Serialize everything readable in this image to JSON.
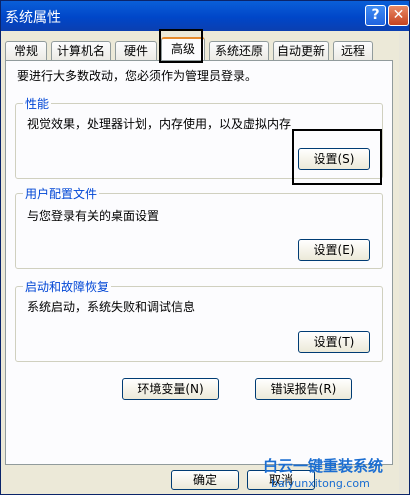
{
  "window": {
    "title": "系统属性",
    "help_glyph": "?",
    "close_glyph": "✕"
  },
  "tabs": [
    {
      "label": "常规"
    },
    {
      "label": "计算机名"
    },
    {
      "label": "硬件"
    },
    {
      "label": "高级",
      "active": true
    },
    {
      "label": "系统还原"
    },
    {
      "label": "自动更新"
    },
    {
      "label": "远程"
    }
  ],
  "intro": "要进行大多数改动，您必须作为管理员登录。",
  "groups": {
    "performance": {
      "title": "性能",
      "desc": "视觉效果，处理器计划，内存使用，以及虚拟内存",
      "button": "设置(S)"
    },
    "profiles": {
      "title": "用户配置文件",
      "desc": "与您登录有关的桌面设置",
      "button": "设置(E)"
    },
    "startup": {
      "title": "启动和故障恢复",
      "desc": "系统启动，系统失败和调试信息",
      "button": "设置(T)"
    }
  },
  "buttons": {
    "env": "环境变量(N)",
    "error": "错误报告(R)",
    "ok": "确定",
    "cancel": "取消"
  },
  "watermark": {
    "line1": "白云一键重装系统",
    "line2": "baiyunxitong.com"
  },
  "colors": {
    "titlebar": "#0046c8",
    "tab_accent": "#e68b2c",
    "group_title": "#0046d5"
  }
}
